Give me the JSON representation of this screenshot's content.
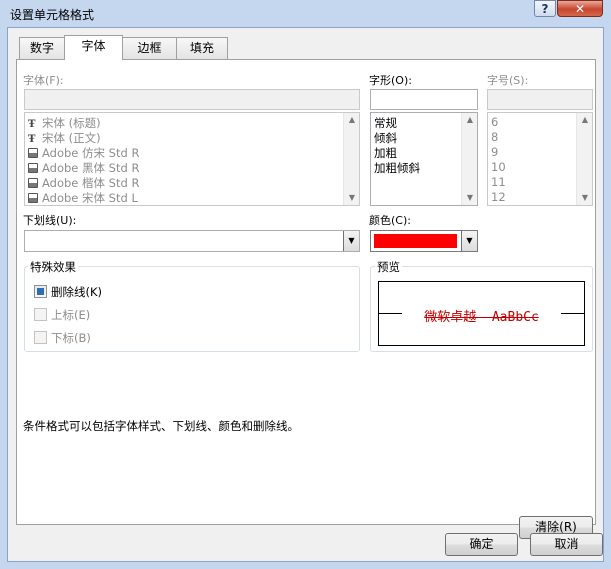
{
  "window": {
    "title": "设置单元格格式",
    "help_label": "?",
    "close_label": "✕"
  },
  "tabs": [
    {
      "label": "数字",
      "active": false
    },
    {
      "label": "字体",
      "active": true
    },
    {
      "label": "边框",
      "active": false
    },
    {
      "label": "填充",
      "active": false
    }
  ],
  "font": {
    "label": "字体(F):",
    "value": "",
    "items": [
      "宋体 (标题)",
      "宋体 (正文)",
      "Adobe 仿宋 Std R",
      "Adobe 黑体 Std R",
      "Adobe 楷体 Std R",
      "Adobe 宋体 Std L"
    ],
    "icons": [
      "truetype-icon",
      "truetype-icon",
      "printer-font-icon",
      "printer-font-icon",
      "printer-font-icon",
      "printer-font-icon"
    ]
  },
  "style": {
    "label": "字形(O):",
    "value": "",
    "items": [
      "常规",
      "倾斜",
      "加粗",
      "加粗倾斜"
    ]
  },
  "size": {
    "label": "字号(S):",
    "value": "",
    "items": [
      "6",
      "8",
      "9",
      "10",
      "11",
      "12"
    ]
  },
  "underline": {
    "label": "下划线(U):",
    "value": ""
  },
  "color": {
    "label": "颜色(C):",
    "swatch": "#ff0000"
  },
  "effects": {
    "title": "特殊效果",
    "strikethrough": {
      "label": "删除线(K)",
      "checked": true
    },
    "superscript": {
      "label": "上标(E)",
      "checked": false
    },
    "subscript": {
      "label": "下标(B)",
      "checked": false
    }
  },
  "preview": {
    "title": "预览",
    "sample": "微软卓越  AaBbCc",
    "color": "#c00000"
  },
  "info_text": "条件格式可以包括字体样式、下划线、颜色和删除线。",
  "buttons": {
    "clear": "清除(R)",
    "ok": "确定",
    "cancel": "取消"
  }
}
